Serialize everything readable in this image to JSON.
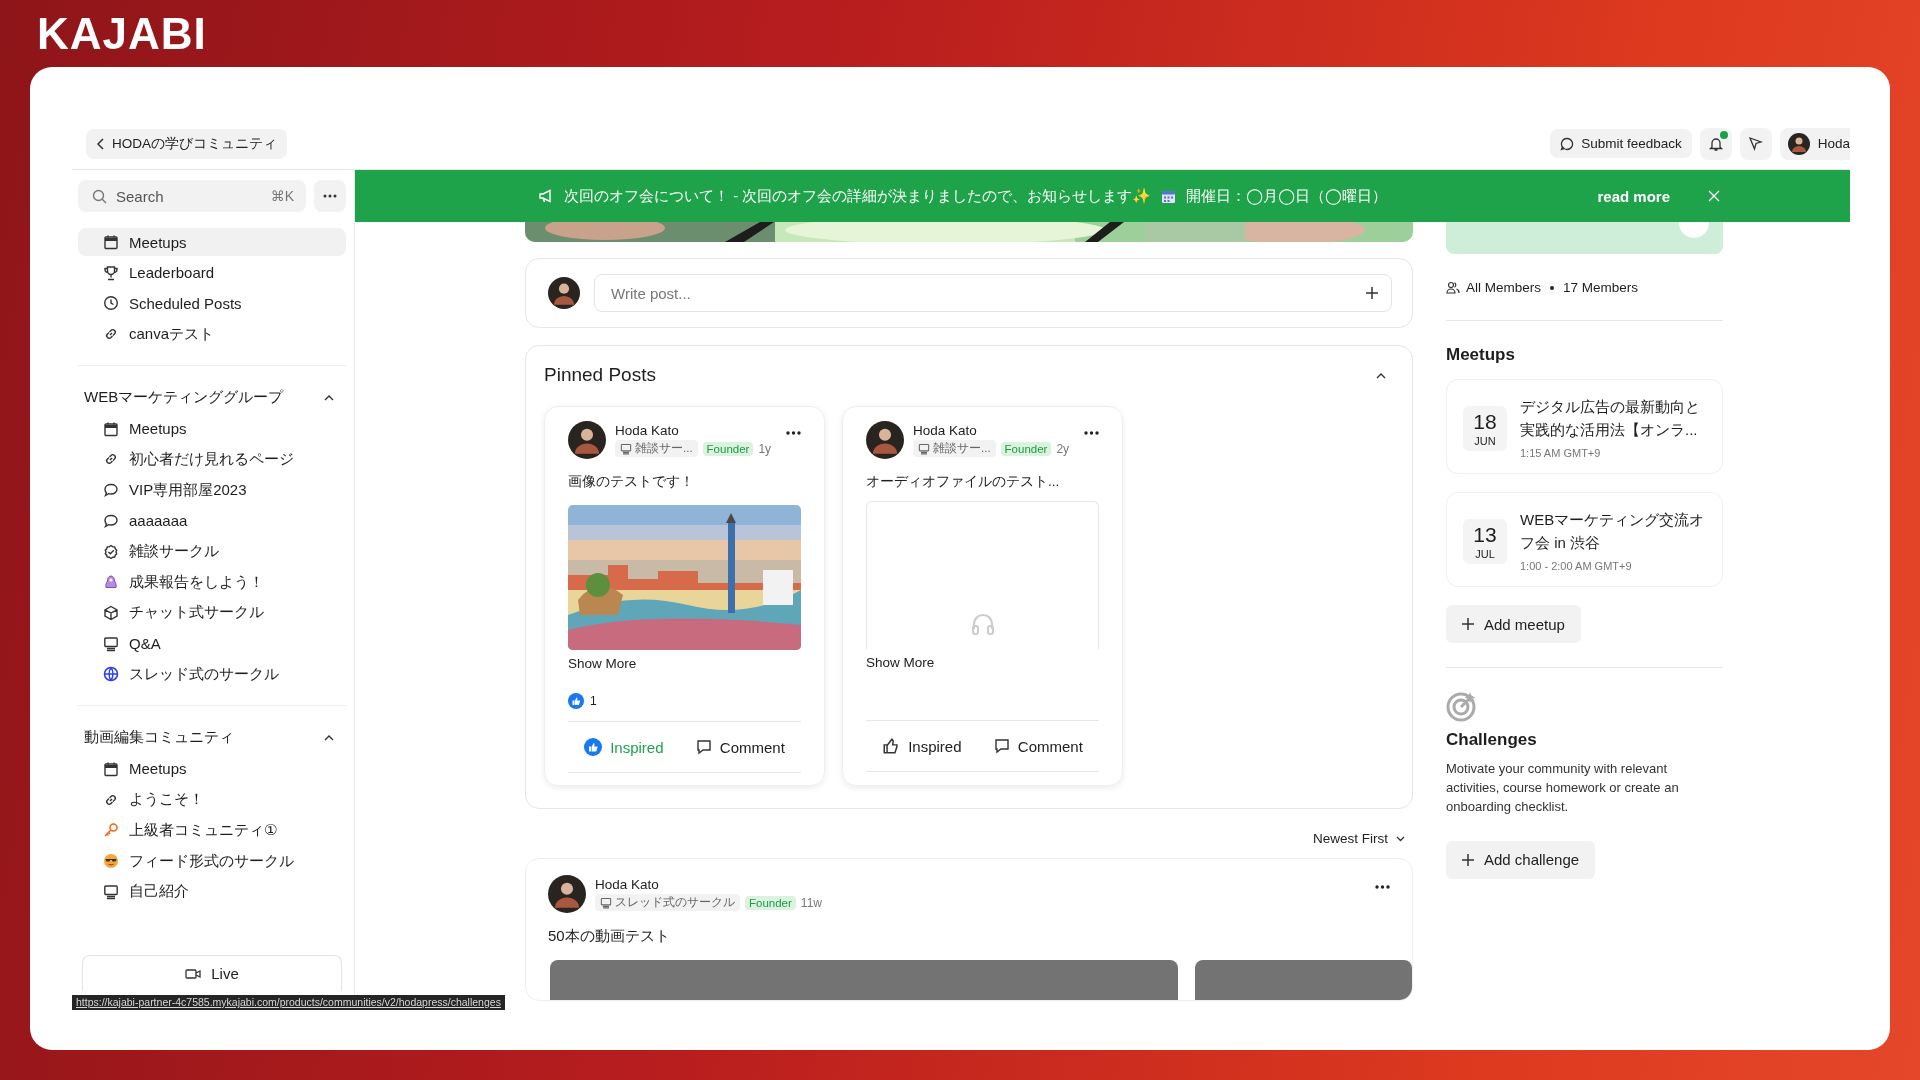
{
  "brand": {
    "logo": "KAJABI"
  },
  "topbar": {
    "back_label": "HODAの学びコミュニティ",
    "feedback": "Submit feedback",
    "notification_dot": true,
    "user": "Hoda"
  },
  "sidebar": {
    "search": {
      "placeholder": "Search",
      "shortcut": "⌘K"
    },
    "top_items": [
      {
        "label": "Meetups",
        "kind": "calendar",
        "selected": true
      },
      {
        "label": "Leaderboard",
        "kind": "trophy",
        "selected": false
      },
      {
        "label": "Scheduled Posts",
        "kind": "clock",
        "selected": false
      },
      {
        "label": "canvaテスト",
        "kind": "link",
        "selected": false
      }
    ],
    "groups": [
      {
        "title": "WEBマーケティンググループ",
        "expanded": true,
        "items": [
          {
            "label": "Meetups",
            "kind": "calendar",
            "selected": false
          },
          {
            "label": "初心者だけ見れるページ",
            "kind": "link",
            "selected": false
          },
          {
            "label": "VIP専用部屋2023",
            "kind": "chat",
            "selected": false
          },
          {
            "label": "aaaaaaa",
            "kind": "chat",
            "selected": false
          },
          {
            "label": "雑談サークル",
            "kind": "badge",
            "selected": false
          },
          {
            "label": "成果報告をしよう！",
            "kind": "figure",
            "selected": false
          },
          {
            "label": "チャット式サークル",
            "kind": "cube",
            "selected": false
          },
          {
            "label": "Q&A",
            "kind": "monitor",
            "selected": false
          },
          {
            "label": "スレッド式のサークル",
            "kind": "globe",
            "selected": false
          }
        ]
      },
      {
        "title": "動画編集コミュニティ",
        "expanded": true,
        "items": [
          {
            "label": "Meetups",
            "kind": "calendar",
            "selected": false
          },
          {
            "label": "ようこそ！",
            "kind": "link",
            "selected": false
          },
          {
            "label": "上級者コミュニティ①",
            "kind": "key",
            "selected": false
          },
          {
            "label": "フィード形式のサークル",
            "kind": "face",
            "selected": false
          },
          {
            "label": "自己紹介",
            "kind": "monitor",
            "selected": false
          }
        ]
      }
    ],
    "live_button": "Live"
  },
  "status_url": "https://kajabi-partner-4c7585.mykajabi.com/products/communities/v2/hodapress/challenges",
  "banner": {
    "text": "次回のオフ会について！ - 次回のオフ会の詳細が決まりましたので、お知らせします✨",
    "date_text": "開催日：◯月◯日（◯曜日）",
    "link": "read more"
  },
  "composer": {
    "placeholder": "Write post..."
  },
  "pinned": {
    "title": "Pinned Posts",
    "expanded": true,
    "posts": [
      {
        "author": "Hoda Kato",
        "circle": "雑談サー...",
        "role": "Founder",
        "time": "1y",
        "text": "画像のテストです！",
        "show_more": "Show More",
        "reactions": "1",
        "inspired": true,
        "actions": [
          "Inspired",
          "Comment"
        ]
      },
      {
        "author": "Hoda Kato",
        "circle": "雑談サー...",
        "role": "Founder",
        "time": "2y",
        "text": "オーディオファイルのテスト...",
        "kind": "audio",
        "show_more": "Show More",
        "inspired": false,
        "actions": [
          "Inspired",
          "Comment"
        ]
      }
    ]
  },
  "sort": "Newest First",
  "feed": [
    {
      "author": "Hoda Kato",
      "circle": "スレッド式のサークル",
      "role": "Founder",
      "time": "11w",
      "text": "50本の動画テスト",
      "kind": "video"
    }
  ],
  "members": {
    "label": "All Members",
    "count": "17 Members"
  },
  "meetups": {
    "title": "Meetups",
    "items": [
      {
        "day": "18",
        "month": "JUN",
        "title": "デジタル広告の最新動向と実践的な活用法【オンラ...",
        "time": "1:15 AM GMT+9"
      },
      {
        "day": "13",
        "month": "JUL",
        "title": "WEBマーケティング交流オフ会 in 渋谷",
        "time": "1:00 - 2:00 AM GMT+9"
      }
    ],
    "add": "Add meetup"
  },
  "challenges": {
    "title": "Challenges",
    "text": "Motivate your community with relevant activities, course homework or create an onboarding checklist.",
    "add": "Add challenge"
  }
}
